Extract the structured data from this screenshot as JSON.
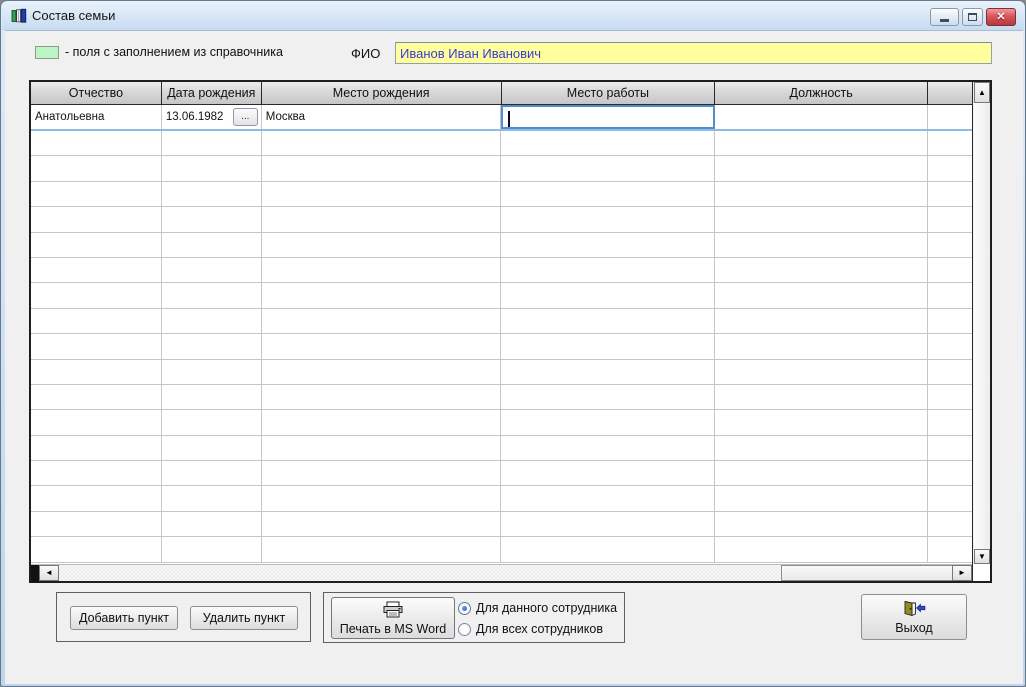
{
  "window": {
    "title": "Состав семьи",
    "icon": "books-icon",
    "controls": {
      "minimize": "minimize-icon",
      "maximize": "maximize-icon",
      "close": "close-icon"
    }
  },
  "legend": {
    "label": "- поля с заполнением из справочника",
    "swatch_color": "#BDF4C3"
  },
  "fio": {
    "label": "ФИО",
    "value": "Иванов Иван Иванович",
    "text_color": "#3A3AD2",
    "field_bg": "#FFFF9E"
  },
  "grid": {
    "columns": [
      "Отчество",
      "Дата рождения",
      "Место рождения",
      "Место работы",
      "Должность",
      ""
    ],
    "rows": [
      {
        "patronymic": "Анатольевна",
        "birth_date": "13.06.1982",
        "date_button": "...",
        "birth_place": "Москва",
        "work_place": "",
        "position": "",
        "extra": ""
      }
    ],
    "empty_row_count": 17,
    "selected_cell": "Место работы"
  },
  "footer": {
    "add_button": "Добавить пункт",
    "delete_button": "Удалить пункт",
    "print_button": "Печать в MS Word",
    "print_icon": "printer-icon",
    "radio_options": [
      {
        "label": "Для данного сотрудника",
        "selected": true
      },
      {
        "label": "Для всех сотрудников",
        "selected": false
      }
    ],
    "exit_button": "Выход",
    "exit_icon": "door-exit-icon"
  },
  "colors": {
    "selected_cell_border": "#4E8FD0",
    "selected_row_border": "#8FBCE6",
    "header_bg": "#D6D6D6",
    "titlebar_gradient": "#DCEBF9",
    "close_button": "#C8444B"
  }
}
